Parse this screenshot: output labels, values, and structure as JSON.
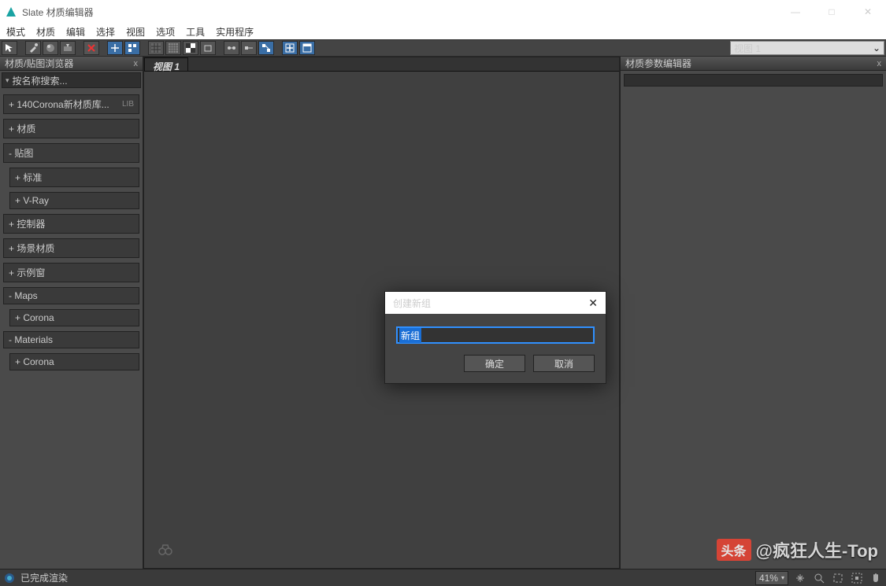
{
  "window": {
    "title": "Slate 材质编辑器",
    "min": "—",
    "max": "□",
    "close": "✕"
  },
  "menu": [
    "模式",
    "材质",
    "编辑",
    "选择",
    "视图",
    "选项",
    "工具",
    "实用程序"
  ],
  "toolbar": {
    "view_dropdown": "视图 1"
  },
  "left_panel": {
    "title": "材质/贴图浏览器",
    "search_placeholder": "按名称搜索...",
    "items": [
      {
        "label": "+ 140Corona新材质库...",
        "suffix": "LIB",
        "sub": false
      },
      {
        "label": "+ 材质",
        "sub": false
      },
      {
        "label": "- 贴图",
        "sub": false
      },
      {
        "label": "+ 标准",
        "sub": true
      },
      {
        "label": "+ V-Ray",
        "sub": true
      },
      {
        "label": "+ 控制器",
        "sub": false
      },
      {
        "label": "+ 场景材质",
        "sub": false
      },
      {
        "label": "+ 示例窗",
        "sub": false
      },
      {
        "label": "- Maps",
        "sub": false
      },
      {
        "label": "+ Corona",
        "sub": true
      },
      {
        "label": "- Materials",
        "sub": false
      },
      {
        "label": "+ Corona",
        "sub": true
      }
    ]
  },
  "center": {
    "tab": "视图 1"
  },
  "right_panel": {
    "title": "材质参数编辑器"
  },
  "dialog": {
    "title": "创建新组",
    "input_value": "新组",
    "ok": "确定",
    "cancel": "取消"
  },
  "status": {
    "text": "已完成渲染",
    "zoom": "41%"
  },
  "watermark": {
    "badge": "头条",
    "text": "@疯狂人生-Top"
  }
}
